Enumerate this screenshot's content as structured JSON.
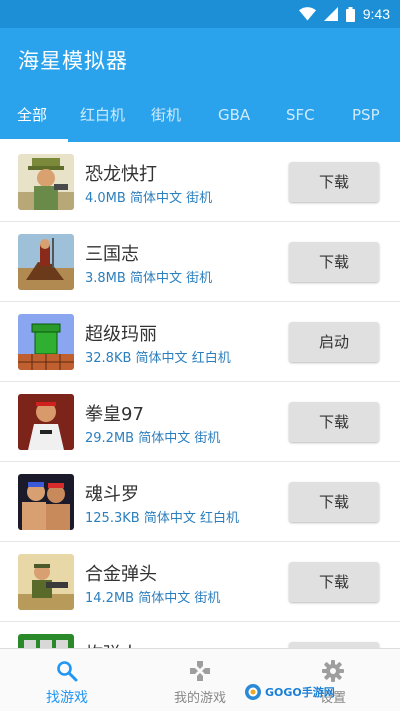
{
  "status_bar": {
    "time": "9:43"
  },
  "app": {
    "title": "海星模拟器"
  },
  "tabs": [
    {
      "label": "全部"
    },
    {
      "label": "红白机"
    },
    {
      "label": "街机"
    },
    {
      "label": "GBA"
    },
    {
      "label": "SFC"
    },
    {
      "label": "PSP"
    }
  ],
  "games": [
    {
      "name": "恐龙快打",
      "size": "4.0MB",
      "language": "简体中文",
      "platform": "街机",
      "action": "下载"
    },
    {
      "name": "三国志",
      "size": "3.8MB",
      "language": "简体中文",
      "platform": "街机",
      "action": "下载"
    },
    {
      "name": "超级玛丽",
      "size": "32.8KB",
      "language": "简体中文",
      "platform": "红白机",
      "action": "启动"
    },
    {
      "name": "拳皇97",
      "size": "29.2MB",
      "language": "简体中文",
      "platform": "街机",
      "action": "下载"
    },
    {
      "name": "魂斗罗",
      "size": "125.3KB",
      "language": "简体中文",
      "platform": "红白机",
      "action": "下载"
    },
    {
      "name": "合金弹头",
      "size": "14.2MB",
      "language": "简体中文",
      "platform": "街机",
      "action": "下载"
    },
    {
      "name": "炸弹人",
      "size": "",
      "language": "",
      "platform": "",
      "action": ""
    }
  ],
  "bottom_nav": [
    {
      "label": "找游戏",
      "icon": "search-icon"
    },
    {
      "label": "我的游戏",
      "icon": "gamepad-icon"
    },
    {
      "label": "设置",
      "icon": "gear-icon"
    }
  ],
  "watermark": {
    "text": "GOGO手游网"
  },
  "colors": {
    "primary": "#2aa3ec",
    "status_bar": "#1c8fd6",
    "meta_text": "#2c7fbe",
    "active_nav": "#2196f3"
  }
}
